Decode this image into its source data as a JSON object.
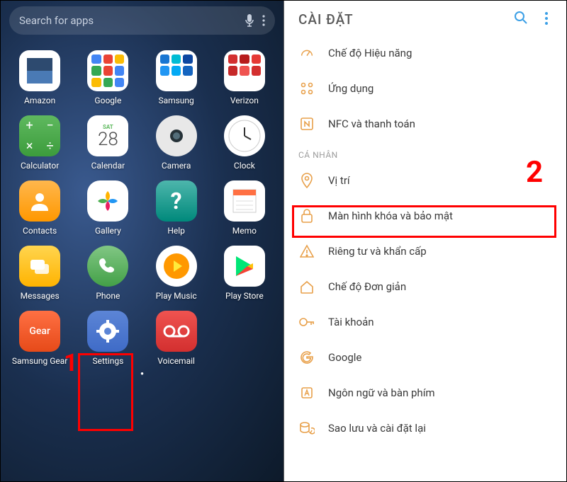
{
  "annotations": {
    "step1": "1",
    "step2": "2"
  },
  "left": {
    "search_placeholder": "Search for apps",
    "apps": [
      {
        "label": "Amazon",
        "icon": "amazon"
      },
      {
        "label": "Google",
        "icon": "google"
      },
      {
        "label": "Samsung",
        "icon": "samsung"
      },
      {
        "label": "Verizon",
        "icon": "verizon"
      },
      {
        "label": "Calculator",
        "icon": "calculator"
      },
      {
        "label": "Calendar",
        "icon": "calendar",
        "detail": {
          "day": "SAT",
          "date": "28"
        }
      },
      {
        "label": "Camera",
        "icon": "camera"
      },
      {
        "label": "Clock",
        "icon": "clock"
      },
      {
        "label": "Contacts",
        "icon": "contacts"
      },
      {
        "label": "Gallery",
        "icon": "gallery"
      },
      {
        "label": "Help",
        "icon": "help"
      },
      {
        "label": "Memo",
        "icon": "memo"
      },
      {
        "label": "Messages",
        "icon": "messages"
      },
      {
        "label": "Phone",
        "icon": "phone"
      },
      {
        "label": "Play Music",
        "icon": "playmusic"
      },
      {
        "label": "Play Store",
        "icon": "playstore"
      },
      {
        "label": "Samsung Gear",
        "icon": "gear"
      },
      {
        "label": "Settings",
        "icon": "settings"
      },
      {
        "label": "Voicemail",
        "icon": "voicemail"
      }
    ]
  },
  "right": {
    "title": "CÀI ĐẶT",
    "items": [
      {
        "type": "item",
        "icon": "gauge",
        "label": "Chế độ Hiệu năng"
      },
      {
        "type": "item",
        "icon": "apps",
        "label": "Ứng dụng"
      },
      {
        "type": "item",
        "icon": "nfc",
        "label": "NFC và thanh toán"
      },
      {
        "type": "section",
        "label": "CÁ NHÂN"
      },
      {
        "type": "item",
        "icon": "location",
        "label": "Vị trí"
      },
      {
        "type": "item",
        "icon": "lock",
        "label": "Màn hình khóa và bảo mật"
      },
      {
        "type": "item",
        "icon": "alert",
        "label": "Riêng tư và khẩn cấp"
      },
      {
        "type": "item",
        "icon": "home",
        "label": "Chế độ Đơn giản"
      },
      {
        "type": "item",
        "icon": "key",
        "label": "Tài khoản"
      },
      {
        "type": "item",
        "icon": "google",
        "label": "Google"
      },
      {
        "type": "item",
        "icon": "lang",
        "label": "Ngôn ngữ và bàn phím"
      },
      {
        "type": "item",
        "icon": "backup",
        "label": "Sao lưu và cài đặt lại"
      }
    ]
  }
}
